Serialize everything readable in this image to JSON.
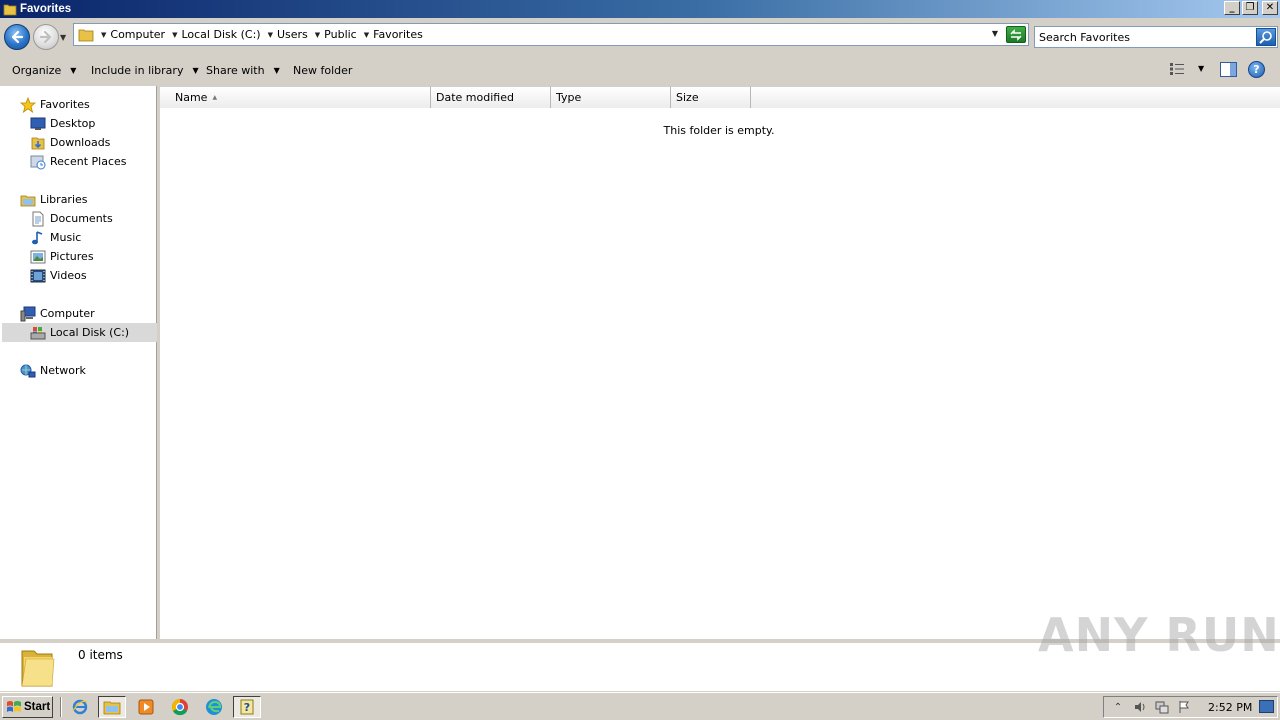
{
  "window": {
    "title": "Favorites",
    "controls": {
      "minimize": "_",
      "restore": "❐",
      "close": "✕"
    }
  },
  "address": {
    "breadcrumbs": [
      "Computer",
      "Local Disk (C:)",
      "Users",
      "Public",
      "Favorites"
    ],
    "search_placeholder": "Search Favorites"
  },
  "toolbar": {
    "organize": "Organize",
    "include_in_library": "Include in library",
    "share_with": "Share with",
    "new_folder": "New folder",
    "help": "?"
  },
  "sidebar": {
    "favorites": {
      "label": "Favorites",
      "items": [
        "Desktop",
        "Downloads",
        "Recent Places"
      ]
    },
    "libraries": {
      "label": "Libraries",
      "items": [
        "Documents",
        "Music",
        "Pictures",
        "Videos"
      ]
    },
    "computer": {
      "label": "Computer",
      "items": [
        "Local Disk (C:)"
      ]
    },
    "network": {
      "label": "Network"
    }
  },
  "columns": [
    "Name",
    "Date modified",
    "Type",
    "Size"
  ],
  "content": {
    "empty_message": "This folder is empty."
  },
  "details": {
    "item_count": "0 items"
  },
  "watermark": "ANY RUN",
  "taskbar": {
    "start_label": "Start",
    "clock": "2:52 PM"
  },
  "colors": {
    "accent": "#0a246a",
    "selection": "#d9d9d9",
    "chrome": "#d4d0c8"
  }
}
